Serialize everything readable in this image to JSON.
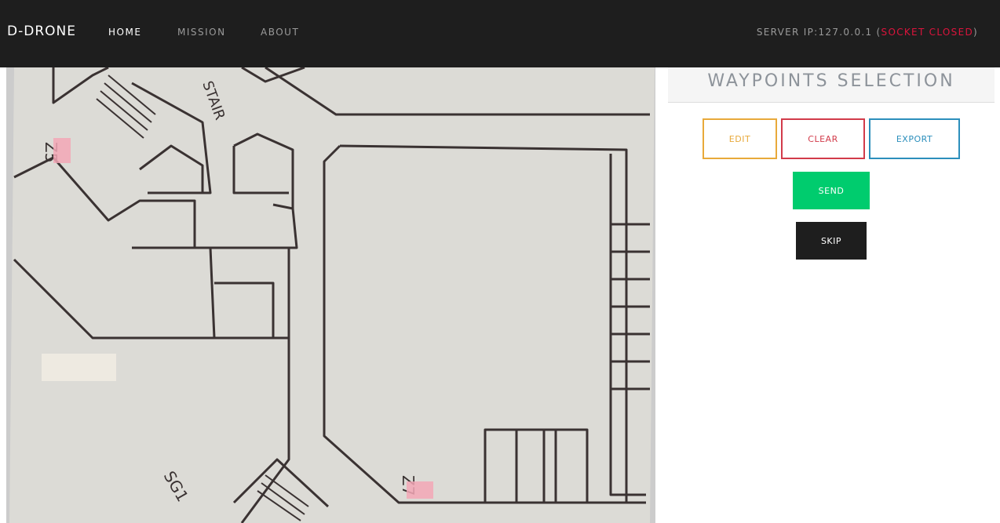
{
  "navbar": {
    "brand": "D-DRONE",
    "links": [
      "HOME",
      "MISSION",
      "ABOUT"
    ],
    "server_label": "SERVER IP:127.0.0.1 (",
    "socket_state": "SOCKET CLOSED",
    "server_suffix": ")"
  },
  "map": {
    "labels": [
      "Z5",
      "Z7",
      "SG1",
      "STAIR"
    ]
  },
  "sidebar": {
    "title": "WAYPOINTS SELECTION",
    "buttons": {
      "edit": "EDIT",
      "clear": "CLEAR",
      "export": "EXPORT",
      "send": "SEND",
      "skip": "SKIP"
    }
  },
  "colors": {
    "navbar_bg": "#1e1e1e",
    "socket_closed": "#dc143c",
    "edit": "#e8a93a",
    "clear": "#d23b4a",
    "export": "#2c8fbc",
    "send": "#00cc6e",
    "skip": "#1e1e1e"
  }
}
